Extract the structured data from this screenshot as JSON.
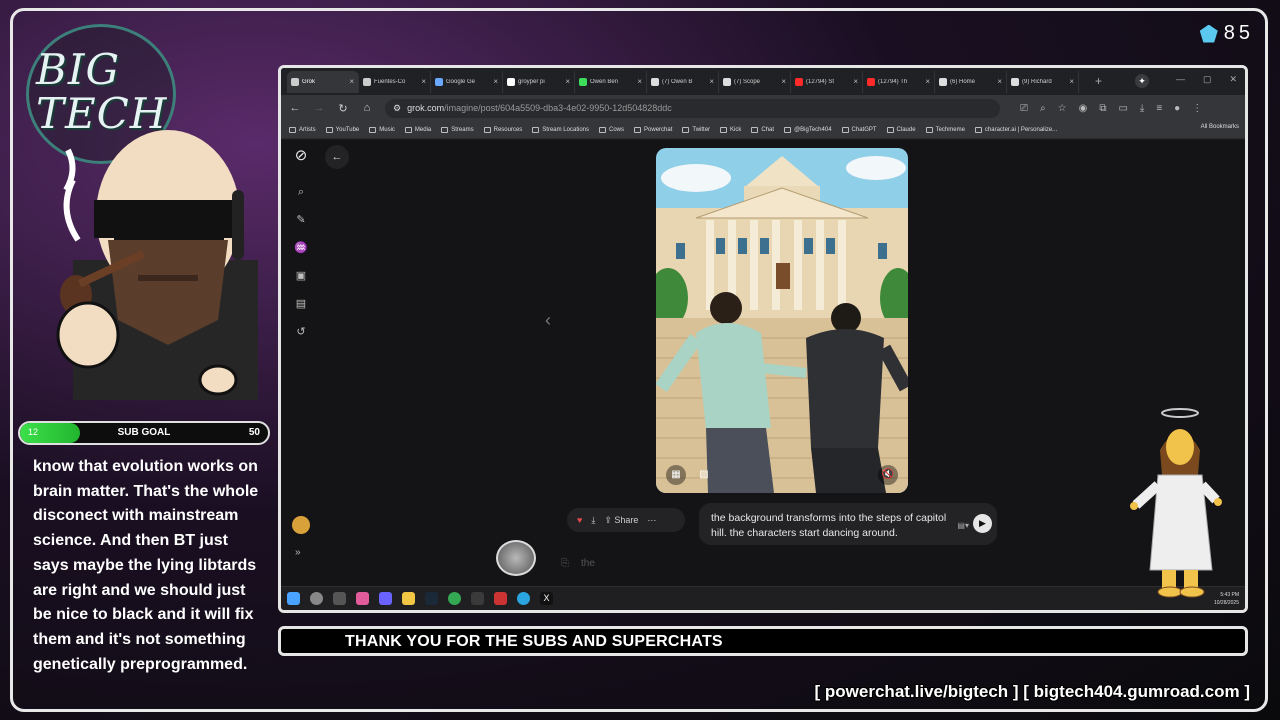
{
  "overlay": {
    "logo_text_line1": "BIG",
    "logo_text_line2": "TECH",
    "gem_count": "85",
    "sub_goal": {
      "label": "SUB GOAL",
      "current": "12",
      "max": "50",
      "progress": 0.24
    },
    "chat_message": "know that evolution works on brain matter. That's the whole disconect with mainstream science. And then BT just says maybe the lying libtards are right and we should just be nice to black and it will fix them and it's not something genetically preprogrammed.",
    "ticker": "THANK YOU FOR THE SUBS AND SUPERCHATS",
    "promo_links": "[ powerchat.live/bigtech ] [ bigtech404.gumroad.com ]"
  },
  "browser": {
    "tabs": [
      {
        "title": "Grok",
        "icon": "grok-icon",
        "color": "#cccccc",
        "active": true
      },
      {
        "title": "Fuentes-Co",
        "icon": "grok-icon",
        "color": "#cccccc"
      },
      {
        "title": "Google Ge",
        "icon": "gemini-icon",
        "color": "#6aa7ff"
      },
      {
        "title": "groyper pi",
        "icon": "google-icon",
        "color": "#ffffff"
      },
      {
        "title": "Owen Ben",
        "icon": "rumble-icon",
        "color": "#3ddc5a"
      },
      {
        "title": "(7) Owen B",
        "icon": "x-icon",
        "color": "#dddddd"
      },
      {
        "title": "(7) Scope",
        "icon": "x-icon",
        "color": "#dddddd"
      },
      {
        "title": "(12794) St",
        "icon": "youtube-icon",
        "color": "#ff2a2a"
      },
      {
        "title": "(12794) Th",
        "icon": "youtube-icon",
        "color": "#ff2a2a"
      },
      {
        "title": "(6) Home",
        "icon": "x-icon",
        "color": "#dddddd"
      },
      {
        "title": "(9) Richard",
        "icon": "x-icon",
        "color": "#dddddd"
      }
    ],
    "url_host": "grok.com",
    "url_path": "/imagine/post/604a5509-dba3-4e02-9950-12d504828ddc",
    "bookmarks": [
      "Artists",
      "YouTube",
      "Music",
      "Media",
      "Streams",
      "Resources",
      "Stream Locations",
      "Cows",
      "Powerchat",
      "Twitter",
      "Kick",
      "Chat",
      "@BigTech404",
      "ChatGPT",
      "Claude",
      "Techmeme",
      "character.ai | Personalize..."
    ],
    "all_bookmarks": "All Bookmarks"
  },
  "grok_page": {
    "share_label": "Share",
    "prompt_text": "the background transforms into the steps of capitol hill. the characters start dancing around.",
    "input_value": "the"
  },
  "taskbar": {
    "time": "5:43 PM",
    "date": "10/28/2025"
  },
  "colors": {
    "accent_green": "#3ce04a",
    "frame": "#e6e6e6",
    "heart": "#e5484d"
  }
}
